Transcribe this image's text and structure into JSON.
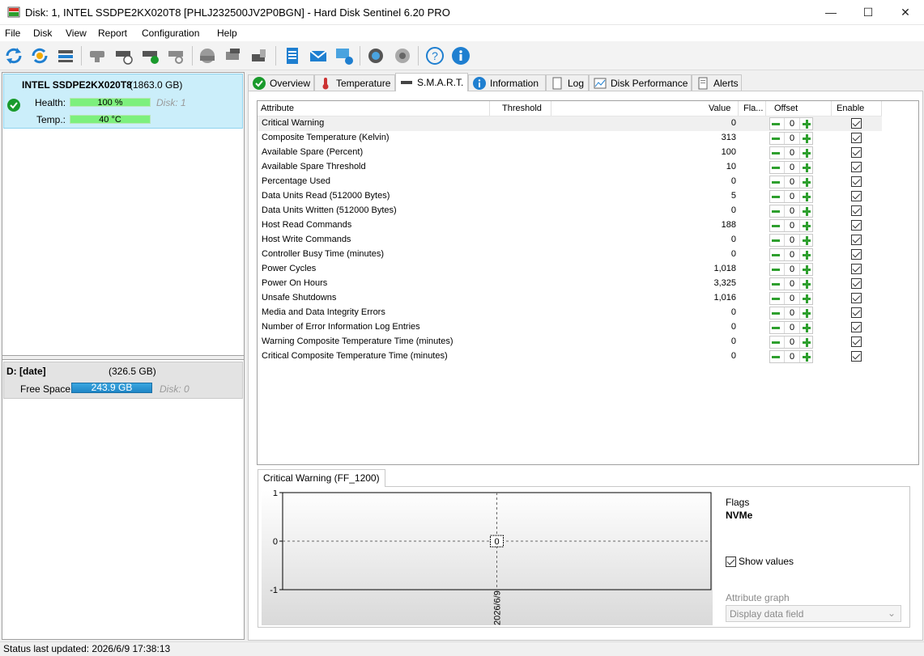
{
  "window": {
    "title": "Disk: 1, INTEL SSDPE2KX020T8 [PHLJ232500JV2P0BGN]  -  Hard Disk Sentinel 6.20 PRO",
    "controls": [
      "—",
      "☐",
      "✕"
    ]
  },
  "menu": [
    "File",
    "Disk",
    "View",
    "Report",
    "Configuration",
    "Help"
  ],
  "disk": {
    "name": "INTEL SSDPE2KX020T8",
    "size": "(1863.0 GB)",
    "health_label": "Health:",
    "health_value": "100 %",
    "health_fraction": 1.0,
    "temp_label": "Temp.:",
    "temp_value": "40 °C",
    "disk_index": "Disk: 1"
  },
  "volume": {
    "name": "D: [date]",
    "size": "(326.5 GB)",
    "free_label": "Free Space",
    "free_value": "243.9 GB",
    "free_fraction": 0.75,
    "disk_index": "Disk: 0"
  },
  "tabs": [
    "Overview",
    "Temperature",
    "S.M.A.R.T.",
    "Information",
    "Log",
    "Disk Performance",
    "Alerts"
  ],
  "smart": {
    "headers": {
      "attribute": "Attribute",
      "threshold": "Threshold",
      "value": "Value",
      "flags": "Fla...",
      "offset": "Offset",
      "enable": "Enable"
    },
    "rows": [
      {
        "attribute": "Critical Warning",
        "value": "0",
        "offset": "0"
      },
      {
        "attribute": "Composite Temperature (Kelvin)",
        "value": "313",
        "offset": "0"
      },
      {
        "attribute": "Available Spare (Percent)",
        "value": "100",
        "offset": "0"
      },
      {
        "attribute": "Available Spare Threshold",
        "value": "10",
        "offset": "0"
      },
      {
        "attribute": "Percentage Used",
        "value": "0",
        "offset": "0"
      },
      {
        "attribute": "Data Units Read (512000 Bytes)",
        "value": "5",
        "offset": "0"
      },
      {
        "attribute": "Data Units Written (512000 Bytes)",
        "value": "0",
        "offset": "0"
      },
      {
        "attribute": "Host Read Commands",
        "value": "188",
        "offset": "0"
      },
      {
        "attribute": "Host Write Commands",
        "value": "0",
        "offset": "0"
      },
      {
        "attribute": "Controller Busy Time (minutes)",
        "value": "0",
        "offset": "0"
      },
      {
        "attribute": "Power Cycles",
        "value": "1,018",
        "offset": "0"
      },
      {
        "attribute": "Power On Hours",
        "value": "3,325",
        "offset": "0"
      },
      {
        "attribute": "Unsafe Shutdowns",
        "value": "1,016",
        "offset": "0"
      },
      {
        "attribute": "Media and Data Integrity Errors",
        "value": "0",
        "offset": "0"
      },
      {
        "attribute": "Number of Error Information Log Entries",
        "value": "0",
        "offset": "0"
      },
      {
        "attribute": "Warning Composite Temperature Time (minutes)",
        "value": "0",
        "offset": "0"
      },
      {
        "attribute": "Critical Composite Temperature Time (minutes)",
        "value": "0",
        "offset": "0"
      }
    ]
  },
  "graph": {
    "tab_label": "Critical Warning (FF_1200)",
    "flags_label": "Flags",
    "flags_value": "NVMe",
    "show_values_label": "Show values",
    "attribute_graph_label": "Attribute graph",
    "attribute_graph_select": "Display data field",
    "point_label": "0"
  },
  "chart_data": {
    "type": "line",
    "x": [
      "2026/6/9"
    ],
    "series": [
      {
        "values": [
          0
        ]
      }
    ],
    "ylim": [
      -1,
      1
    ],
    "yticks": [
      "1",
      "0",
      "-1"
    ],
    "grid": true
  },
  "status": "Status last updated: 2026/6/9 17:38:13",
  "colors": {
    "selected_disk_bg": "#cbeefa",
    "health_bar": "#7df07d",
    "free_space_bar": "#1f86c6",
    "ok_green": "#1a9a2c",
    "offset_green": "#2e9f2e"
  }
}
